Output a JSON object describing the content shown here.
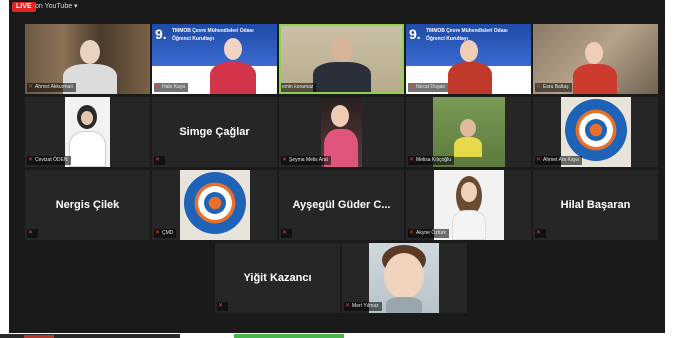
{
  "topbar": {
    "live_label": "LIVE",
    "youtube_label": "on YouTube ▾"
  },
  "tiles": [
    {
      "id": "t1",
      "name": "Ahmet Akkurman",
      "kind": "video"
    },
    {
      "id": "t2",
      "name": "Hale Kaya",
      "kind": "video"
    },
    {
      "id": "t3",
      "name": "emin koramaz",
      "kind": "video",
      "active": true
    },
    {
      "id": "t4",
      "name": "Necat Dogan",
      "kind": "video"
    },
    {
      "id": "t5",
      "name": "Esra Baltaş",
      "kind": "video"
    },
    {
      "id": "t6",
      "name": "Cevizat ÖDEN",
      "kind": "video"
    },
    {
      "id": "t7",
      "name": "Simge Çağlar",
      "kind": "name"
    },
    {
      "id": "t8",
      "name": "Şeyma Melis Arat",
      "kind": "video"
    },
    {
      "id": "t9",
      "name": "Melisa Kılıçoğlu",
      "kind": "video"
    },
    {
      "id": "t10",
      "name": "Ahmet Ata Kaya",
      "kind": "logo"
    },
    {
      "id": "t11",
      "name": "Nergis Çilek",
      "kind": "name"
    },
    {
      "id": "t12",
      "name": "ÇMD",
      "kind": "logo"
    },
    {
      "id": "t13",
      "name": "Ayşegül Güder C...",
      "kind": "name"
    },
    {
      "id": "t14",
      "name": "Akyne Öztürk",
      "kind": "video"
    },
    {
      "id": "t15",
      "name": "Hilal Başaran",
      "kind": "name"
    },
    {
      "id": "t16",
      "name": "Yiğit Kazancı",
      "kind": "name"
    },
    {
      "id": "t17",
      "name": "Mert Yılmaz",
      "kind": "video"
    }
  ],
  "banner": {
    "number": "9.",
    "line1": "TMMOB Çevre Mühendisleri Odası",
    "line2": "Öğrenci Kurultayı"
  },
  "logo": {
    "top_text": "çevre görevleri odası",
    "bottom_text": "çevre mühendisi"
  },
  "colors": {
    "live_red": "#e02424",
    "active_border": "#8fd14f",
    "tile_bg": "#262626"
  }
}
